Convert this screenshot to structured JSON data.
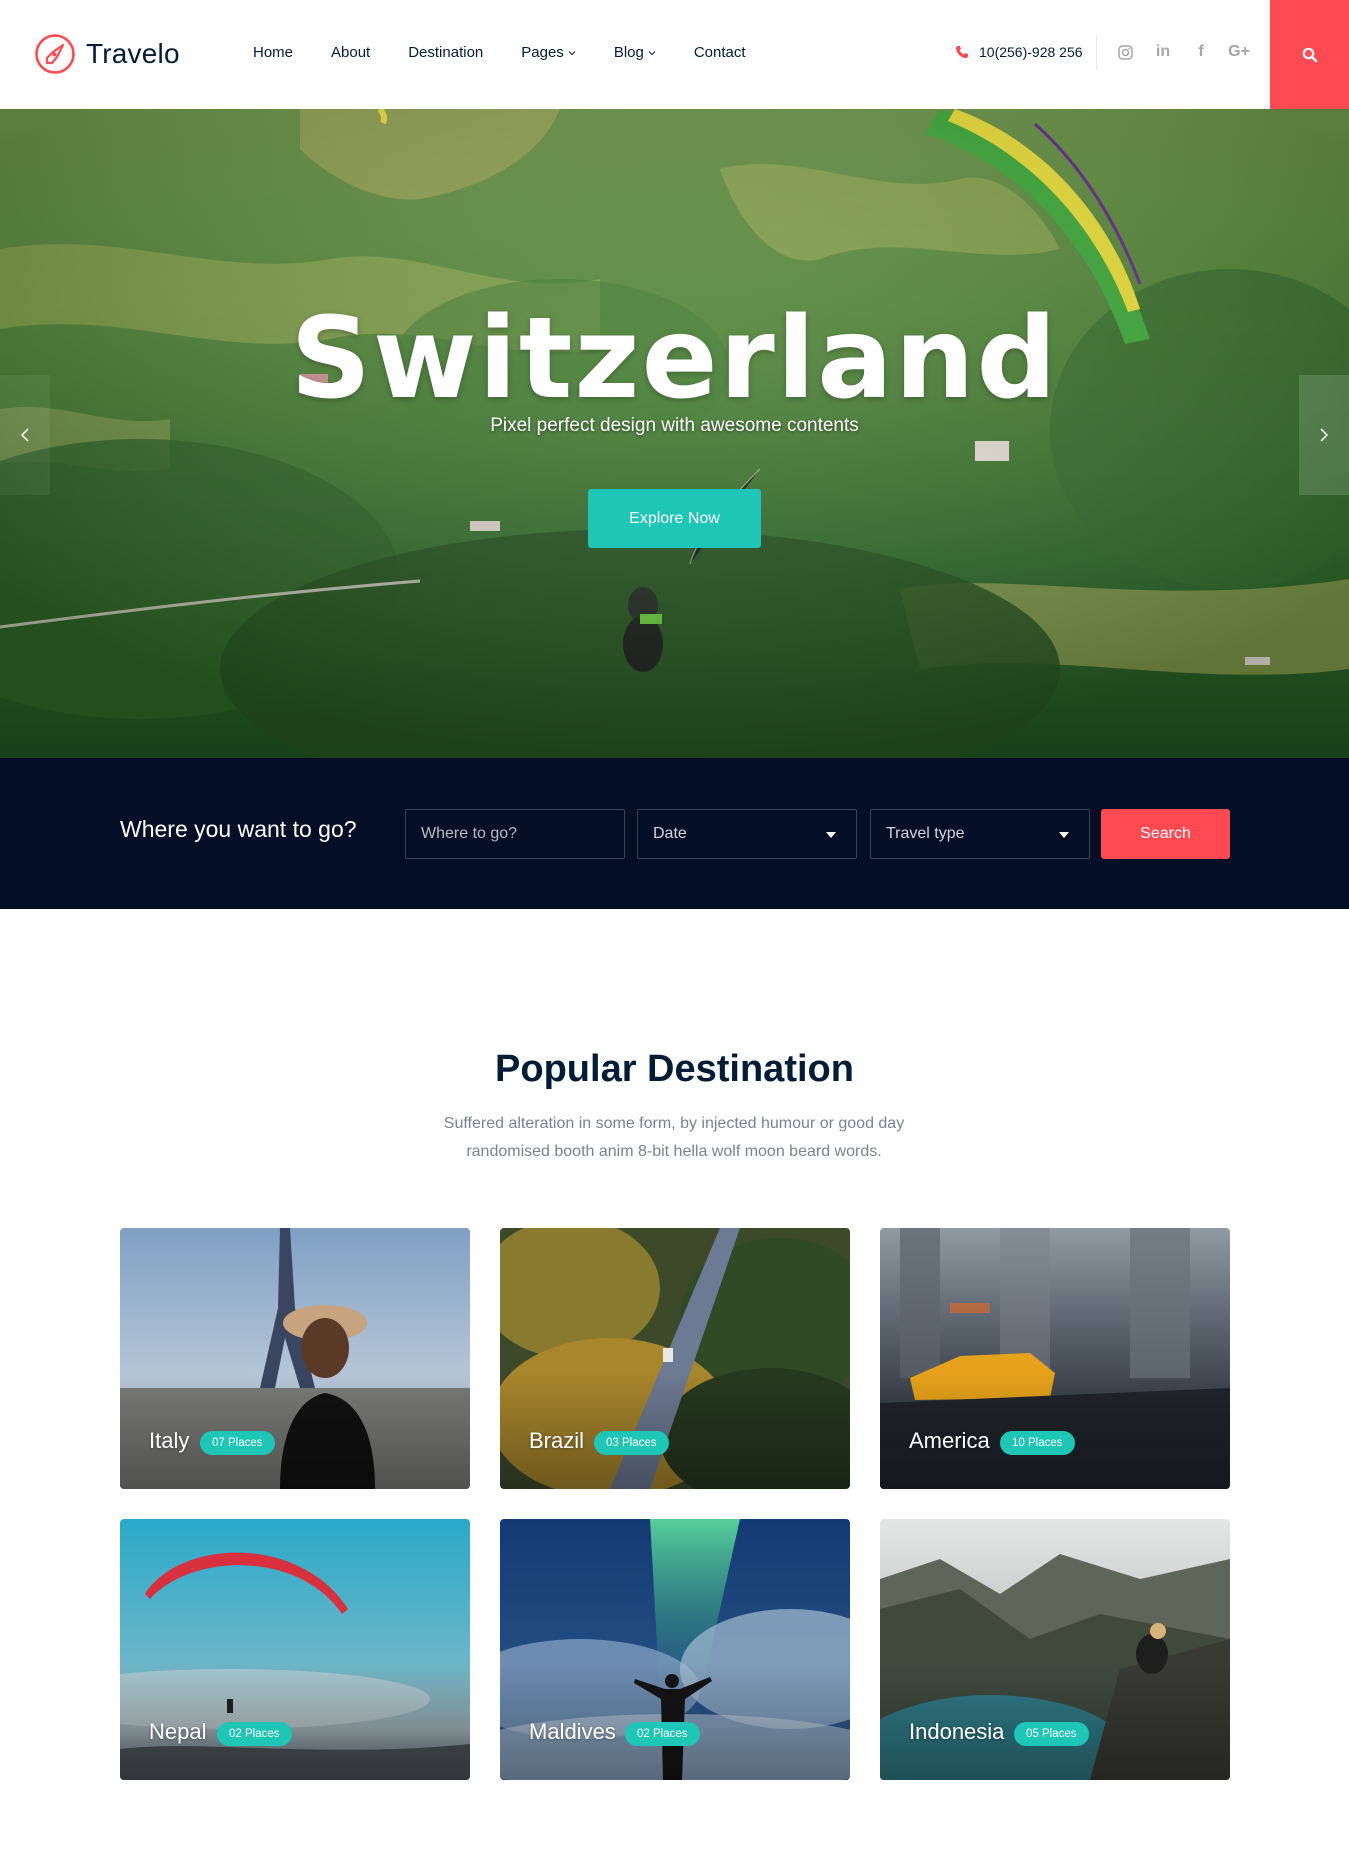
{
  "brand": {
    "name": "Travelo",
    "accent": "#ff4a52",
    "teal": "#1ec6b6",
    "navy": "#040e27"
  },
  "nav": [
    {
      "label": "Home",
      "dropdown": false
    },
    {
      "label": "About",
      "dropdown": false
    },
    {
      "label": "Destination",
      "dropdown": false
    },
    {
      "label": "Pages",
      "dropdown": true
    },
    {
      "label": "Blog",
      "dropdown": true
    },
    {
      "label": "Contact",
      "dropdown": false
    }
  ],
  "header": {
    "phone": "10(256)-928 256",
    "socials": [
      "instagram-icon",
      "linkedin-icon",
      "facebook-icon",
      "google-plus-icon"
    ],
    "social_labels": {
      "linkedin": "in",
      "facebook": "f",
      "google": "G+"
    },
    "search_icon": "search-icon"
  },
  "hero": {
    "title": "Switzerland",
    "subtitle": "Pixel perfect design with awesome contents",
    "cta": "Explore Now"
  },
  "search": {
    "heading": "Where you want to go?",
    "where_placeholder": "Where to go?",
    "date_value": "Date",
    "type_value": "Travel type",
    "button": "Search"
  },
  "popular": {
    "title": "Popular Destination",
    "description_line1": "Suffered alteration in some form, by injected humour or good day",
    "description_line2": "randomised booth anim 8-bit hella wolf moon beard words.",
    "destinations": [
      {
        "name": "Italy",
        "places": "07 Places"
      },
      {
        "name": "Brazil",
        "places": "03 Places"
      },
      {
        "name": "America",
        "places": "10 Places"
      },
      {
        "name": "Nepal",
        "places": "02 Places"
      },
      {
        "name": "Maldives",
        "places": "02 Places"
      },
      {
        "name": "Indonesia",
        "places": "05 Places"
      }
    ]
  }
}
